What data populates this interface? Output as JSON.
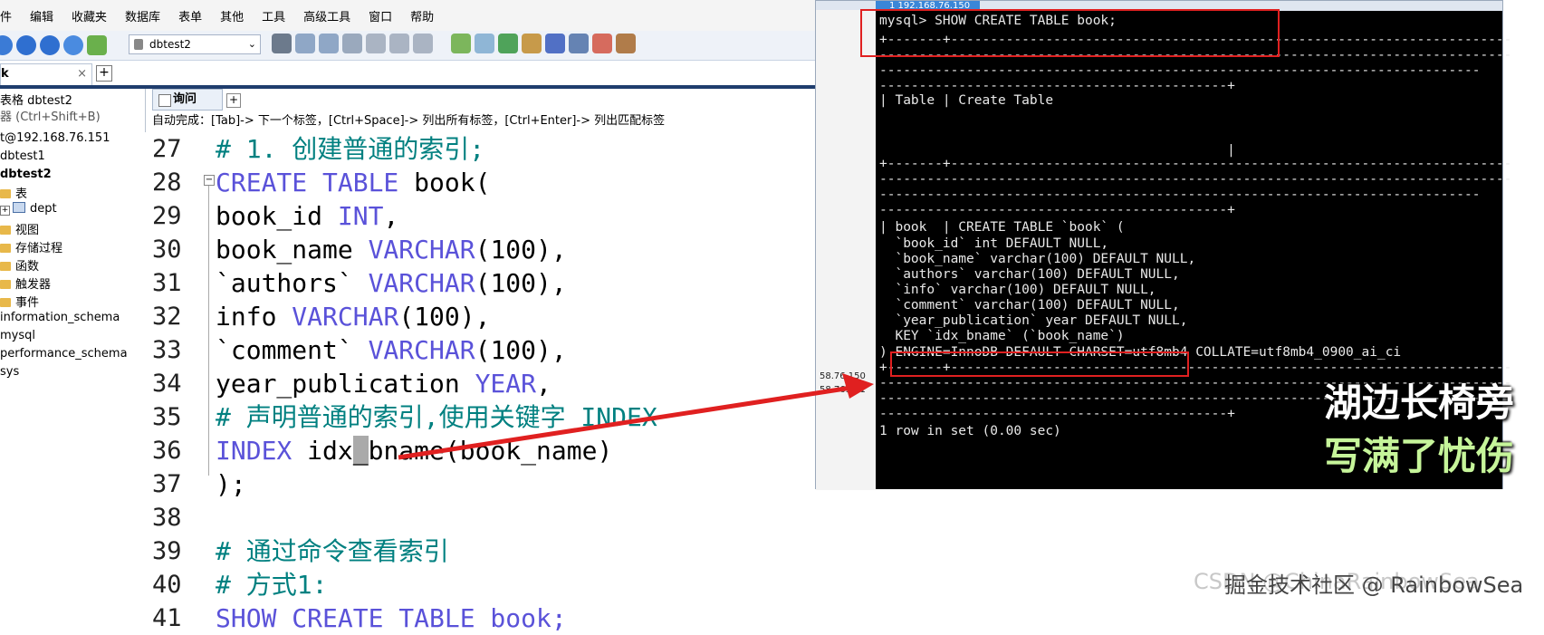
{
  "menu": [
    "件",
    "编辑",
    "收藏夹",
    "数据库",
    "表单",
    "其他",
    "工具",
    "高级工具",
    "窗口",
    "帮助"
  ],
  "toolbar": {
    "database_selected": "dbtest2"
  },
  "left_tab": {
    "label": "k",
    "close": "×",
    "add": "+"
  },
  "tree": {
    "header": "表格 dbtest2",
    "filter_placeholder": "器 (Ctrl+Shift+B)",
    "connection": "t@192.168.76.151",
    "items": [
      {
        "label": "dbtest1"
      },
      {
        "label": "dbtest2"
      },
      {
        "label": "表"
      },
      {
        "label": "dept"
      },
      {
        "label": "视图"
      },
      {
        "label": "存储过程"
      },
      {
        "label": "函数"
      },
      {
        "label": "触发器"
      },
      {
        "label": "事件"
      },
      {
        "label": "information_schema"
      },
      {
        "label": "mysql"
      },
      {
        "label": "performance_schema"
      },
      {
        "label": "sys"
      }
    ]
  },
  "query_tab": {
    "label": "询问",
    "add": "+"
  },
  "hint": "自动完成：[Tab]-> 下一个标签，[Ctrl+Space]-> 列出所有标签，[Ctrl+Enter]-> 列出匹配标签",
  "editor": {
    "line_numbers": [
      "27",
      "28",
      "29",
      "30",
      "31",
      "32",
      "33",
      "34",
      "35",
      "36",
      "37",
      "38",
      "39",
      "40",
      "41"
    ],
    "lines": [
      {
        "t": "# 1. 创建普通的索引;"
      },
      {
        "a": "CREATE TABLE ",
        "b": "book("
      },
      {
        "a": "book_id ",
        "b": "INT",
        ",": ","
      },
      {
        "a": "book_name ",
        "b": "VARCHAR",
        "c": "(100),"
      },
      {
        "a": "`authors` ",
        "b": "VARCHAR",
        "c": "(100),"
      },
      {
        "a": "info ",
        "b": "VARCHAR",
        "c": "(100),"
      },
      {
        "a": "`comment` ",
        "b": "VARCHAR",
        "c": "(100),"
      },
      {
        "a": "year_publication ",
        "b": "YEAR",
        "c": ","
      },
      {
        "t": "# 声明普通的索引,使用关键字 INDEX"
      },
      {
        "a": "INDEX ",
        "b": "idx",
        "cur": "_",
        "c": "bname(book_name)"
      },
      {
        "t": ");"
      },
      {
        "t": ""
      },
      {
        "t": "# 通过命令查看索引"
      },
      {
        "t": "# 方式1:"
      },
      {
        "t": "SHOW CREATE TABLE book;"
      }
    ]
  },
  "terminal": {
    "tab_title": "1 192.168.76.150",
    "side_ips": [
      "58.76.150",
      "58.76.151"
    ],
    "lines": [
      "mysql> SHOW CREATE TABLE book;",
      "+-------+-----------------------------------------------------------------------",
      "--------------------------------------------------------------------------------",
      "----------------------------------------------------------------------------",
      "--------------------------------------------+",
      "| Table | Create Table",
      "",
      "",
      "                                            |",
      "+-------+-----------------------------------------------------------------------",
      "--------------------------------------------------------------------------------",
      "----------------------------------------------------------------------------",
      "--------------------------------------------+",
      "| book  | CREATE TABLE `book` (",
      "  `book_id` int DEFAULT NULL,",
      "  `book_name` varchar(100) DEFAULT NULL,",
      "  `authors` varchar(100) DEFAULT NULL,",
      "  `info` varchar(100) DEFAULT NULL,",
      "  `comment` varchar(100) DEFAULT NULL,",
      "  `year_publication` year DEFAULT NULL,",
      "  KEY `idx_bname` (`book_name`)",
      ") ENGINE=InnoDB DEFAULT CHARSET=utf8mb4 COLLATE=utf8mb4_0900_ai_ci",
      "+-------+-----------------------------------------------------------------------",
      "--------------------------------------------------------------------------------",
      "----------------------------------------------------------------------------",
      "--------------------------------------------+",
      "1 row in set (0.00 sec)"
    ]
  },
  "overlay": {
    "lyric1": "湖边长椅旁",
    "lyric2": "写满了忧伤",
    "watermark": "掘金技术社区 @ RainbowSea",
    "watermark_under": "CSDN @ChinaRainbowSea",
    "annotation_color": "#e02020"
  }
}
